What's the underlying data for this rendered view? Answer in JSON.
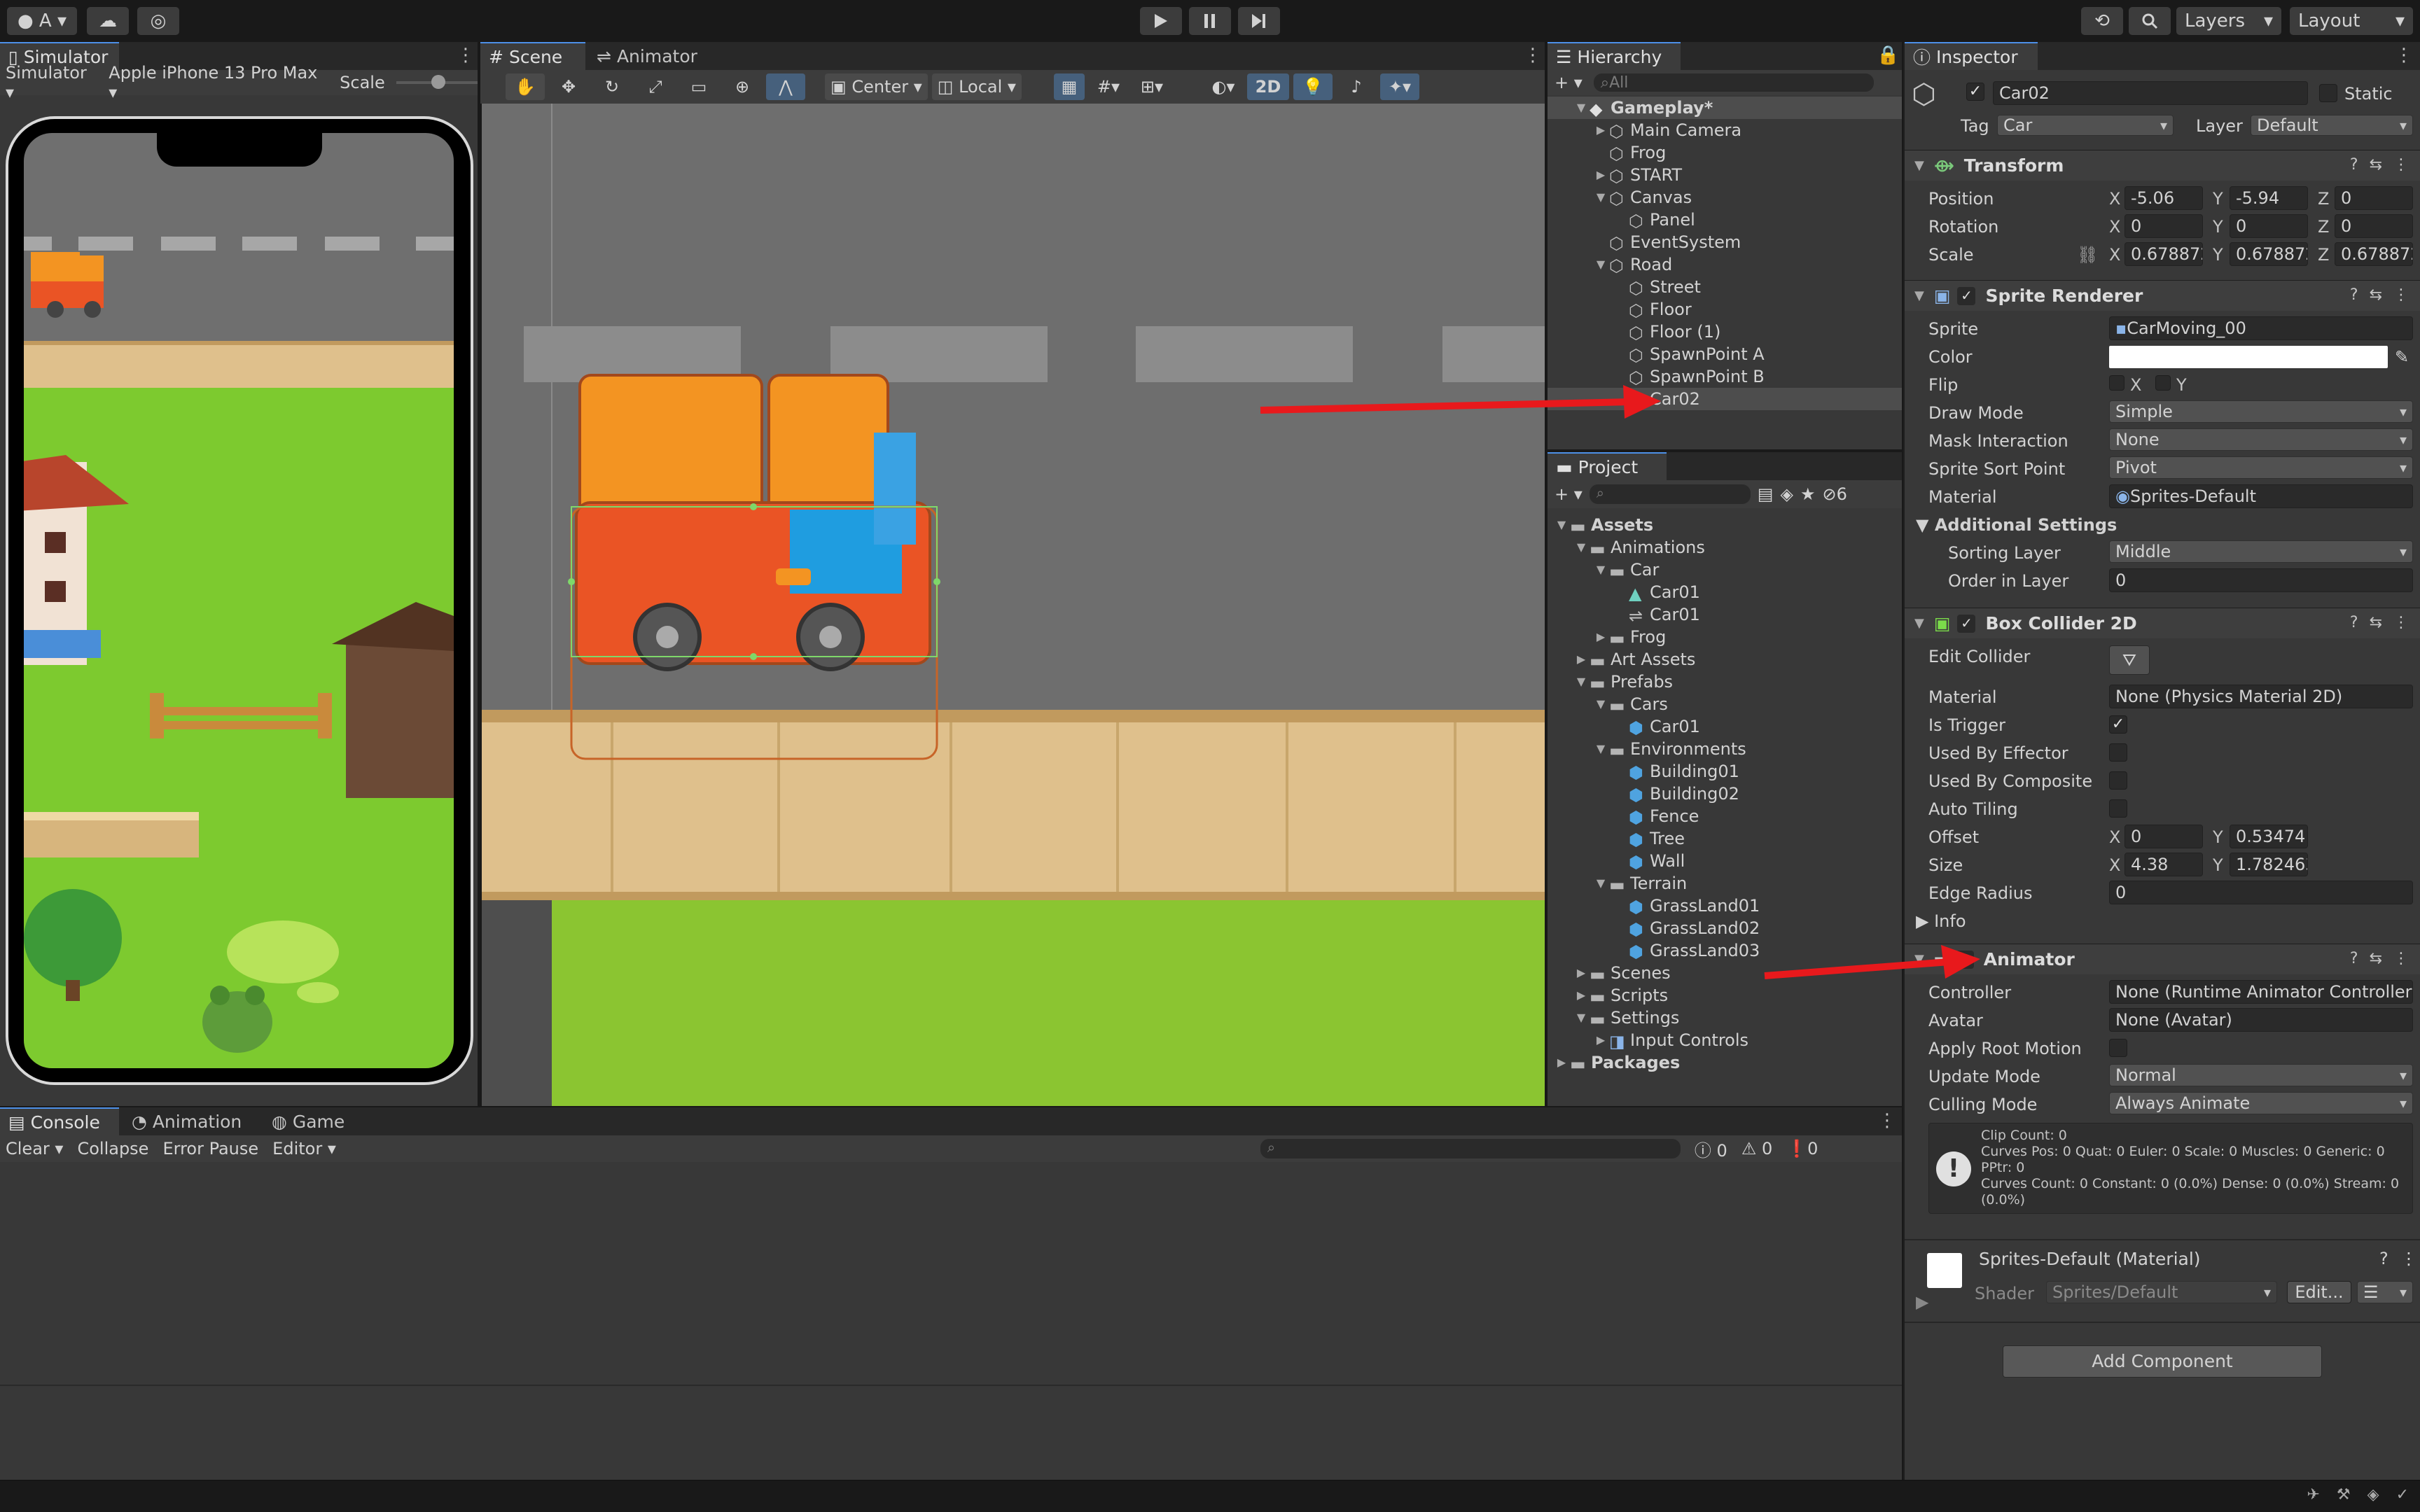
{
  "toolbar": {
    "account": "A",
    "layers": "Layers",
    "layout": "Layout"
  },
  "simulator": {
    "tab": "Simulator",
    "mode": "Simulator",
    "device": "Apple iPhone 13 Pro Max",
    "scale": "Scale"
  },
  "scene": {
    "tab_scene": "Scene",
    "tab_animator": "Animator",
    "pivot": "Center",
    "space": "Local",
    "mode_2d": "2D"
  },
  "hierarchy": {
    "tab": "Hierarchy",
    "search": "All",
    "items": [
      {
        "label": "Gameplay*"
      },
      {
        "label": "Main Camera"
      },
      {
        "label": "Frog"
      },
      {
        "label": "START"
      },
      {
        "label": "Canvas"
      },
      {
        "label": "Panel"
      },
      {
        "label": "EventSystem"
      },
      {
        "label": "Road"
      },
      {
        "label": "Street"
      },
      {
        "label": "Floor"
      },
      {
        "label": "Floor (1)"
      },
      {
        "label": "SpawnPoint A"
      },
      {
        "label": "SpawnPoint B"
      },
      {
        "label": "Car02"
      }
    ]
  },
  "project": {
    "tab": "Project",
    "count": "6",
    "items": [
      {
        "label": "Assets"
      },
      {
        "label": "Animations"
      },
      {
        "label": "Car"
      },
      {
        "label": "Car01"
      },
      {
        "label": "Car01"
      },
      {
        "label": "Frog"
      },
      {
        "label": "Art Assets"
      },
      {
        "label": "Prefabs"
      },
      {
        "label": "Cars"
      },
      {
        "label": "Car01"
      },
      {
        "label": "Environments"
      },
      {
        "label": "Building01"
      },
      {
        "label": "Building02"
      },
      {
        "label": "Fence"
      },
      {
        "label": "Tree"
      },
      {
        "label": "Wall"
      },
      {
        "label": "Terrain"
      },
      {
        "label": "GrassLand01"
      },
      {
        "label": "GrassLand02"
      },
      {
        "label": "GrassLand03"
      },
      {
        "label": "Scenes"
      },
      {
        "label": "Scripts"
      },
      {
        "label": "Settings"
      },
      {
        "label": "Input Controls"
      },
      {
        "label": "Packages"
      }
    ]
  },
  "console": {
    "tab_console": "Console",
    "tab_animation": "Animation",
    "tab_game": "Game",
    "clear": "Clear",
    "collapse": "Collapse",
    "error_pause": "Error Pause",
    "editor": "Editor",
    "count_info": "0",
    "count_warn": "0",
    "count_error": "0"
  },
  "inspector": {
    "tab": "Inspector",
    "name": "Car02",
    "static": "Static",
    "tag_label": "Tag",
    "tag": "Car",
    "layer_label": "Layer",
    "layer": "Default",
    "transform": {
      "title": "Transform",
      "position": "Position",
      "rotation": "Rotation",
      "scale": "Scale",
      "pos_x": "-5.06",
      "pos_y": "-5.94",
      "pos_z": "0",
      "rot_x": "0",
      "rot_y": "0",
      "rot_z": "0",
      "sc_x": "0.678872",
      "sc_y": "0.678872",
      "sc_z": "0.678872"
    },
    "sprite_renderer": {
      "title": "Sprite Renderer",
      "sprite_label": "Sprite",
      "sprite": "CarMoving_00",
      "color_label": "Color",
      "flip_label": "Flip",
      "draw_mode_label": "Draw Mode",
      "draw_mode": "Simple",
      "mask_label": "Mask Interaction",
      "mask": "None",
      "sort_point_label": "Sprite Sort Point",
      "sort_point": "Pivot",
      "material_label": "Material",
      "material": "Sprites-Default",
      "additional": "Additional Settings",
      "sorting_layer_label": "Sorting Layer",
      "sorting_layer": "Middle",
      "order_label": "Order in Layer",
      "order": "0"
    },
    "box_collider": {
      "title": "Box Collider 2D",
      "edit_label": "Edit Collider",
      "material_label": "Material",
      "material": "None (Physics Material 2D)",
      "is_trigger": "Is Trigger",
      "used_by_effector": "Used By Effector",
      "used_by_composite": "Used By Composite",
      "auto_tiling": "Auto Tiling",
      "offset_label": "Offset",
      "offset_x": "0",
      "offset_y": "0.53474",
      "size_label": "Size",
      "size_x": "4.38",
      "size_y": "1.782463",
      "edge_radius_label": "Edge Radius",
      "edge_radius": "0",
      "info": "Info"
    },
    "animator": {
      "title": "Animator",
      "controller_label": "Controller",
      "controller": "None (Runtime Animator Controller)",
      "avatar_label": "Avatar",
      "avatar": "None (Avatar)",
      "root_motion_label": "Apply Root Motion",
      "update_label": "Update Mode",
      "update": "Normal",
      "culling_label": "Culling Mode",
      "culling": "Always Animate",
      "info_lines": [
        "Clip Count: 0",
        "Curves Pos: 0 Quat: 0 Euler: 0 Scale: 0 Muscles: 0 Generic: 0",
        "PPtr: 0",
        "Curves Count: 0 Constant: 0 (0.0%) Dense: 0 (0.0%) Stream: 0",
        "(0.0%)"
      ]
    },
    "material": {
      "title": "Sprites-Default (Material)",
      "shader_label": "Shader",
      "shader": "Sprites/Default",
      "edit": "Edit..."
    },
    "add_component": "Add Component"
  },
  "colors": {
    "accent": "#4d90e8",
    "arrow": "#e8191c",
    "selection": "#2c5d87",
    "panel": "#383838"
  }
}
